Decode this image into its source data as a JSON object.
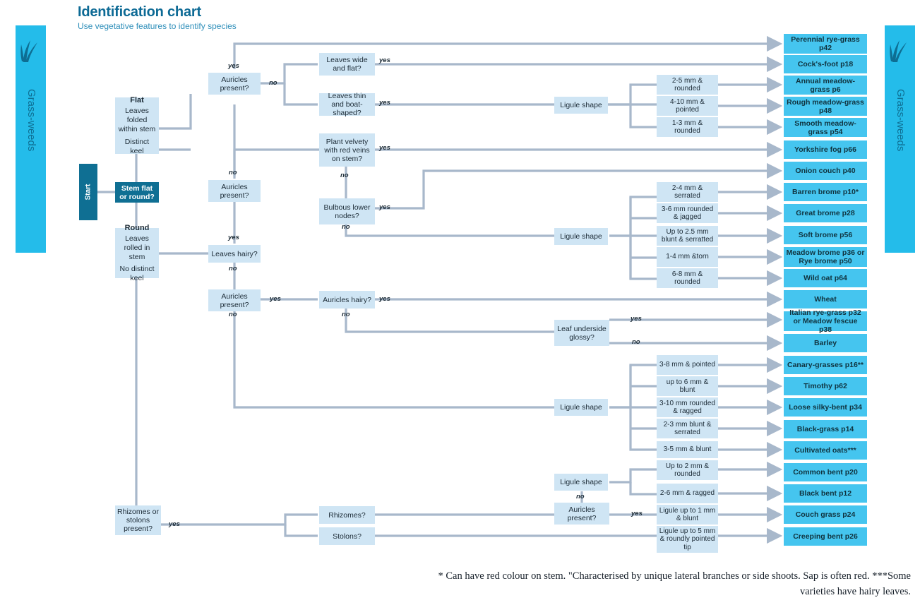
{
  "header": {
    "title": "Identification chart",
    "subtitle": "Use vegetative features to identify species"
  },
  "side_tabs": {
    "left_label": "Grass-weeds",
    "right_label": "Grass-weeds",
    "icon": "grass-leaf-icon",
    "color": "#24bcea"
  },
  "colors": {
    "accent": "#24bcea",
    "result_box": "#45c5ef",
    "node_box": "#cfe5f4",
    "start_box": "#0f6f93",
    "title": "#0d6a95",
    "wire": "#a8b8cb"
  },
  "start": {
    "bar_label": "Start",
    "question": "Stem flat or round?"
  },
  "stages": [
    {
      "id": "flat",
      "title": "Flat",
      "lines": "Leaves folded within stem",
      "lines2": "Distinct keel"
    },
    {
      "id": "round",
      "title": "Round",
      "lines": "Leaves rolled in stem",
      "lines2": "No distinct keel"
    }
  ],
  "questions": [
    {
      "id": "auricles-1",
      "label": "Auricles present?"
    },
    {
      "id": "leaves-wide",
      "label": "Leaves wide and flat?"
    },
    {
      "id": "leaves-thin",
      "label": "Leaves thin and boat-shaped?"
    },
    {
      "id": "auricles-2",
      "label": "Auricles present?"
    },
    {
      "id": "plant-velvety",
      "label": "Plant velvety with red veins on stem?"
    },
    {
      "id": "bulbous-nodes",
      "label": "Bulbous lower nodes?"
    },
    {
      "id": "leaves-hairy",
      "label": "Leaves hairy?"
    },
    {
      "id": "auricles-3",
      "label": "Auricles present?"
    },
    {
      "id": "auricles-hairy",
      "label": "Auricles hairy?"
    },
    {
      "id": "leaf-glossy",
      "label": "Leaf underside glossy?"
    },
    {
      "id": "rhizomes-stolons",
      "label": "Rhizomes or stolons present?"
    },
    {
      "id": "rhizomes",
      "label": "Rhizomes?"
    },
    {
      "id": "stolons",
      "label": "Stolons?"
    },
    {
      "id": "auricles-4",
      "label": "Auricles present?"
    }
  ],
  "ligule_nodes": [
    {
      "id": "ligule-1",
      "label": "Ligule shape"
    },
    {
      "id": "ligule-2",
      "label": "Ligule shape"
    },
    {
      "id": "ligule-3",
      "label": "Ligule shape"
    },
    {
      "id": "ligule-4",
      "label": "Ligule shape"
    }
  ],
  "measurements": [
    {
      "id": "m1",
      "label": "2-5 mm & rounded"
    },
    {
      "id": "m2",
      "label": "4-10 mm & pointed"
    },
    {
      "id": "m3",
      "label": "1-3 mm & rounded"
    },
    {
      "id": "m4",
      "label": "2-4 mm & serrated"
    },
    {
      "id": "m5",
      "label": "3-6 mm rounded & jagged"
    },
    {
      "id": "m6",
      "label": "Up to 2.5 mm blunt & serratted"
    },
    {
      "id": "m7",
      "label": "1-4 mm &torn"
    },
    {
      "id": "m8",
      "label": "6-8 mm & rounded"
    },
    {
      "id": "m9",
      "label": "3-8 mm & pointed"
    },
    {
      "id": "m10",
      "label": "up to 6 mm & blunt"
    },
    {
      "id": "m11",
      "label": "3-10 mm rounded & ragged"
    },
    {
      "id": "m12",
      "label": "2-3 mm blunt & serrated"
    },
    {
      "id": "m13",
      "label": "3-5 mm & blunt"
    },
    {
      "id": "m14",
      "label": "Up to 2 mm & rounded"
    },
    {
      "id": "m15",
      "label": "2-6 mm & ragged"
    },
    {
      "id": "m16",
      "label": "Ligule up to 1 mm & blunt"
    },
    {
      "id": "m17",
      "label": "Ligule up to 5 mm & roundly pointed tip"
    }
  ],
  "results": [
    {
      "id": "r1",
      "label": "Perennial rye-grass p42"
    },
    {
      "id": "r2",
      "label": "Cock's-foot p18"
    },
    {
      "id": "r3",
      "label": "Annual meadow-grass p6"
    },
    {
      "id": "r4",
      "label": "Rough meadow-grass p48"
    },
    {
      "id": "r5",
      "label": "Smooth meadow-grass p54"
    },
    {
      "id": "r6",
      "label": "Yorkshire fog p66"
    },
    {
      "id": "r7",
      "label": "Onion couch p40"
    },
    {
      "id": "r8",
      "label": "Barren brome p10*"
    },
    {
      "id": "r9",
      "label": "Great brome p28"
    },
    {
      "id": "r10",
      "label": "Soft brome p56"
    },
    {
      "id": "r11",
      "label": "Meadow brome p36 or Rye brome p50"
    },
    {
      "id": "r12",
      "label": "Wild oat p64"
    },
    {
      "id": "r13",
      "label": "Wheat"
    },
    {
      "id": "r14",
      "label": "Italian rye-grass p32 or Meadow fescue p38"
    },
    {
      "id": "r15",
      "label": "Barley"
    },
    {
      "id": "r16",
      "label": "Canary-grasses p16**"
    },
    {
      "id": "r17",
      "label": "Timothy p62"
    },
    {
      "id": "r18",
      "label": "Loose silky-bent p34"
    },
    {
      "id": "r19",
      "label": "Black-grass p14"
    },
    {
      "id": "r20",
      "label": "Cultivated oats***"
    },
    {
      "id": "r21",
      "label": "Common bent p20"
    },
    {
      "id": "r22",
      "label": "Black bent p12"
    },
    {
      "id": "r23",
      "label": "Couch grass p24"
    },
    {
      "id": "r24",
      "label": "Creeping bent p26"
    }
  ],
  "edge_labels": {
    "yes": "yes",
    "no": "no"
  },
  "footnote": "* Can have red colour on stem. \"Characterised by unique lateral branches or side shoots. Sap is often red. ***Some varieties have hairy leaves."
}
